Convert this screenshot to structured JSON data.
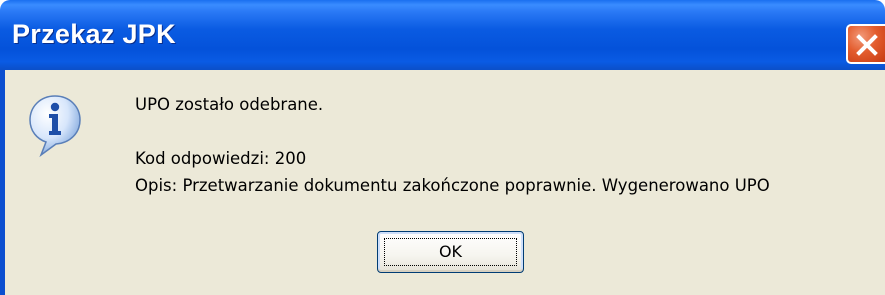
{
  "window": {
    "title": "Przekaz JPK",
    "close_icon": "close-icon"
  },
  "dialog": {
    "icon": "information-icon",
    "message_line1": "UPO zostało odebrane.",
    "message_line2": "Kod odpowiedzi: 200",
    "message_line3": "Opis: Przetwarzanie dokumentu zakończone poprawnie. Wygenerowano UPO",
    "ok_label": "OK"
  },
  "colors": {
    "titlebar": "#0a5be2",
    "client_bg": "#ece9d8",
    "close_button": "#e35d2e"
  }
}
